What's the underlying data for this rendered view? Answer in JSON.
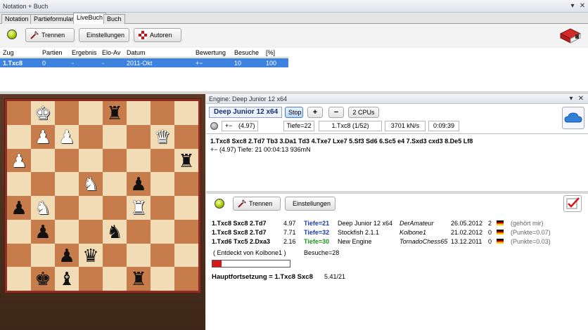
{
  "window": {
    "title": "Notation + Buch"
  },
  "tabs": [
    {
      "label": "Notation",
      "active": false
    },
    {
      "label": "Partieformular",
      "active": false
    },
    {
      "label": "LiveBuch",
      "active": true
    },
    {
      "label": "Buch",
      "active": false
    }
  ],
  "toolbar": {
    "trennen": "Trennen",
    "einstellungen": "Einstellungen",
    "autoren": "Autoren"
  },
  "grid": {
    "headers": [
      "Zug",
      "Partien",
      "Ergebnis",
      "Elo-Av",
      "Datum",
      "Bewertung",
      "Besuche",
      "[%]"
    ],
    "row": [
      "1.Txc8",
      "0",
      "-",
      "-",
      "2011-Okt",
      "+−",
      "10",
      "100"
    ]
  },
  "board": [
    [
      "",
      "wK",
      "",
      "",
      "bR",
      "",
      "",
      ""
    ],
    [
      "",
      "wP",
      "wP",
      "",
      "",
      "",
      "wQ",
      ""
    ],
    [
      "wP",
      "",
      "",
      "",
      "",
      "",
      "",
      "bR"
    ],
    [
      "",
      "",
      "",
      "wN",
      "",
      "bP",
      "",
      ""
    ],
    [
      "bP",
      "wN",
      "",
      "",
      "",
      "wR",
      "",
      ""
    ],
    [
      "",
      "bP",
      "",
      "",
      "bN",
      "",
      "",
      ""
    ],
    [
      "",
      "",
      "bP",
      "bQ",
      "",
      "",
      "",
      ""
    ],
    [
      "",
      "bK",
      "bB",
      "",
      "",
      "bR",
      "",
      ""
    ]
  ],
  "engine": {
    "title": "Engine: Deep Junior 12 x64",
    "name": "Deep Junior 12 x64",
    "stop": "Stop",
    "plus": "+",
    "minus": "−",
    "cpus": "2 CPUs",
    "eval_sign": "+−",
    "eval": "(4.97)",
    "depth": "Tiefe=22",
    "move": "1.Txc8 (1/52)",
    "speed": "3701 kN/s",
    "time": "0:09:39",
    "line1": "1.Txc8 Sxc8 2.Td7 Tb3 3.Da1 Td3 4.Txe7 Lxe7 5.Sf3 Sd6 6.Sc5 e4 7.Sxd3 cxd3 8.De5 Lf8",
    "line2": "+−  (4.97)    Tiefe: 21   00:04:13  936mN"
  },
  "book": {
    "trennen": "Trennen",
    "einstellungen": "Einstellungen",
    "rows": [
      {
        "moves": "1.Txc8 Sxc8 2.Td7",
        "score": "4.97",
        "depth": "Tiefe=21",
        "engine": "Deep Junior 12 x64",
        "author": "DerAmateur",
        "date": "26.05.2012",
        "count": "2",
        "note": "(gehört mir)",
        "depth_color": "#1c3db0"
      },
      {
        "moves": "1.Txc8 Sxc8 2.Td7",
        "score": "7.71",
        "depth": "Tiefe=32",
        "engine": "Stockfish 2.1.1",
        "author": "Kolbone1",
        "date": "21.02.2012",
        "count": "0",
        "note": "(Punkte=0.07)",
        "depth_color": "#1c3db0"
      },
      {
        "moves": "1.Txd6 Txc5 2.Dxa3",
        "score": "2.16",
        "depth": "Tiefe=30",
        "engine": "New Engine",
        "author": "TornadoChess65",
        "date": "13.12.2011",
        "count": "0",
        "note": "(Punkte=0.03)",
        "depth_color": "#1a9a1a"
      }
    ],
    "discovered": "( Entdeckt von Kolbone1 )",
    "visits": "Besuche=28",
    "main_label": "Hauptfortsetzung = 1.Txc8 Sxc8",
    "main_score": "5.41/21"
  },
  "colors": {
    "accent": "#3e82e0",
    "board_light": "#f1dcb6",
    "board_dark": "#c67c4b",
    "frame": "#8a2d22"
  }
}
